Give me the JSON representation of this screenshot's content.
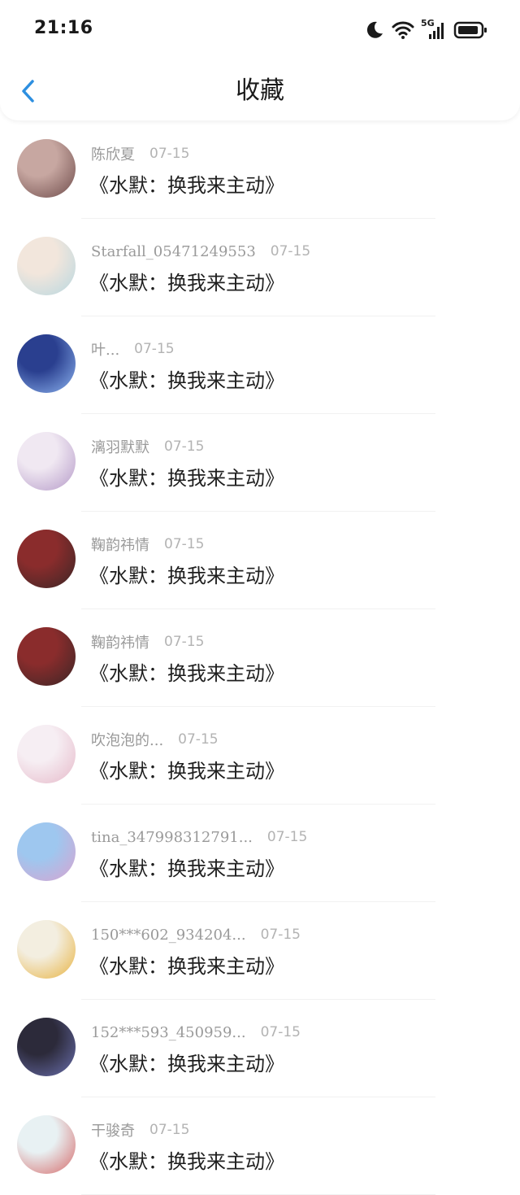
{
  "status_bar": {
    "time": "21:16",
    "network_label": "5G"
  },
  "nav": {
    "title": "收藏",
    "back_icon": "chevron-left-icon",
    "accent_color": "#2d8fe0"
  },
  "items": [
    {
      "username": "陈欣夏",
      "date": "07-15",
      "title": "《水默：换我来主动》",
      "avatar_colors": [
        "#c7a7a1",
        "#6e4b4a"
      ]
    },
    {
      "username": "Starfall_05471249553",
      "date": "07-15",
      "title": "《水默：换我来主动》",
      "avatar_colors": [
        "#f2e6dc",
        "#b7d7e0"
      ]
    },
    {
      "username": "叶...",
      "date": "07-15",
      "title": "《水默：换我来主动》",
      "avatar_colors": [
        "#2a3f8f",
        "#8db4f0"
      ]
    },
    {
      "username": "漓羽默默",
      "date": "07-15",
      "title": "《水默：换我来主动》",
      "avatar_colors": [
        "#f0e8f2",
        "#b59ac8"
      ]
    },
    {
      "username": "鞠韵祎情",
      "date": "07-15",
      "title": "《水默：换我来主动》",
      "avatar_colors": [
        "#8a2c2c",
        "#3a2626"
      ]
    },
    {
      "username": "鞠韵祎情",
      "date": "07-15",
      "title": "《水默：换我来主动》",
      "avatar_colors": [
        "#8a2c2c",
        "#3a2626"
      ]
    },
    {
      "username": "吹泡泡的...",
      "date": "07-15",
      "title": "《水默：换我来主动》",
      "avatar_colors": [
        "#f6eef3",
        "#e6b9c9"
      ]
    },
    {
      "username": "tina_347998312791...",
      "date": "07-15",
      "title": "《水默：换我来主动》",
      "avatar_colors": [
        "#9ec7ef",
        "#d9a3d0"
      ]
    },
    {
      "username": "150***602_934204...",
      "date": "07-15",
      "title": "《水默：换我来主动》",
      "avatar_colors": [
        "#f3eee0",
        "#e8b341"
      ]
    },
    {
      "username": "152***593_450959...",
      "date": "07-15",
      "title": "《水默：换我来主动》",
      "avatar_colors": [
        "#2c2a3a",
        "#6a6fae"
      ]
    },
    {
      "username": "干骏奇",
      "date": "07-15",
      "title": "《水默：换我来主动》",
      "avatar_colors": [
        "#e8f1f3",
        "#d66a6a"
      ]
    }
  ]
}
